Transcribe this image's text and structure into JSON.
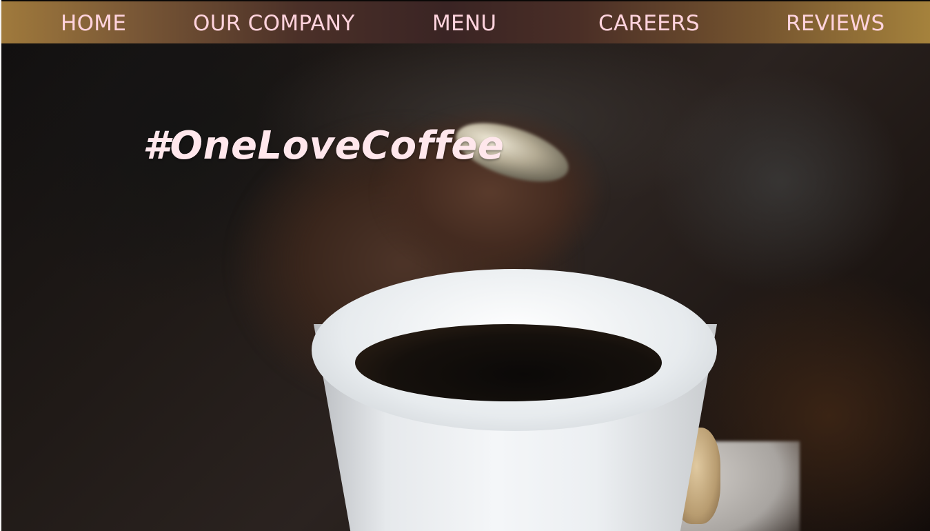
{
  "nav": {
    "items": [
      {
        "label": "HOME"
      },
      {
        "label": "OUR COMPANY"
      },
      {
        "label": "MENU"
      },
      {
        "label": "CAREERS"
      },
      {
        "label": "REVIEWS"
      }
    ]
  },
  "hero": {
    "hashtag": "#OneLoveCoffee",
    "image": "coffee-cup-photo"
  },
  "colors": {
    "nav_text": "#ffd3dd",
    "hashtag_text": "#ffe7ec",
    "nav_gradient_edge": "#a07a3c",
    "nav_gradient_center": "#3a2424"
  }
}
